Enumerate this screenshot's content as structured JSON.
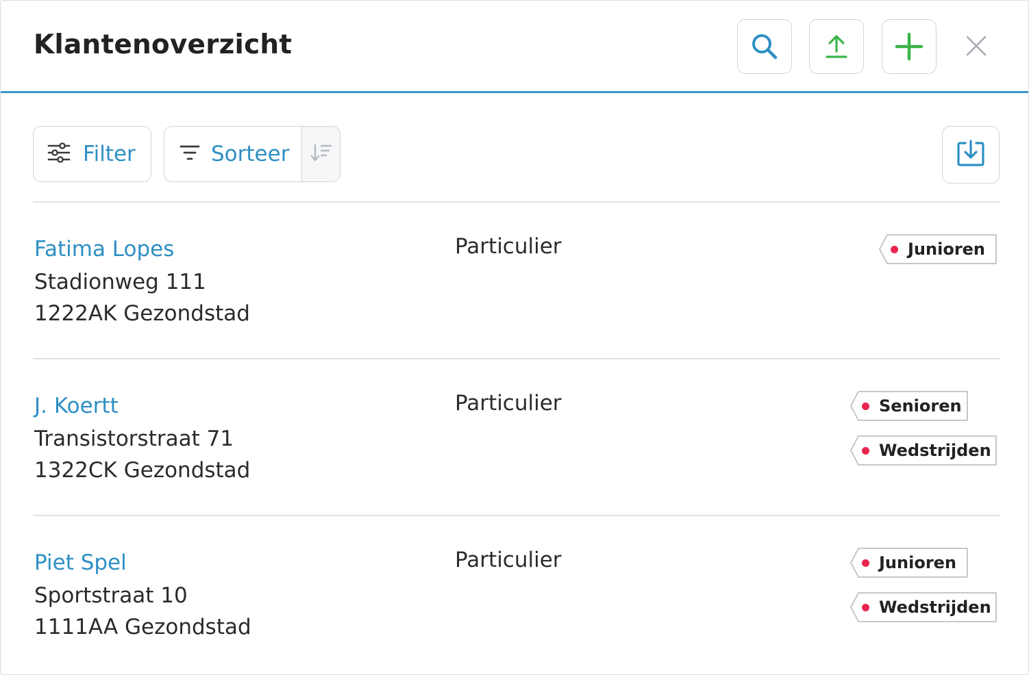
{
  "header": {
    "title": "Klantenoverzicht",
    "actions": [
      {
        "name": "search",
        "icon": "search-icon",
        "color": "#2e8fc4"
      },
      {
        "name": "upload",
        "icon": "upload-icon",
        "color": "#3cb44a"
      },
      {
        "name": "add",
        "icon": "plus-icon",
        "color": "#3cb44a"
      }
    ],
    "close_icon": "close-icon",
    "accent_color": "#3d96c7"
  },
  "toolbar": {
    "filter_label": "Filter",
    "filter_icon": "sliders-icon",
    "sort_label": "Sorteer",
    "sort_icon": "sort-lines-icon",
    "sort_direction_icon": "sort-descending-icon",
    "download_icon": "download-icon"
  },
  "customers": [
    {
      "name": "Fatima Lopes",
      "street": "Stadionweg 111",
      "city": "1222AK Gezondstad",
      "type": "Particulier",
      "tags": [
        "Junioren"
      ]
    },
    {
      "name": "J. Koertt",
      "street": "Transistorstraat 71",
      "city": "1322CK Gezondstad",
      "type": "Particulier",
      "tags": [
        "Senioren",
        "Wedstrijden"
      ]
    },
    {
      "name": "Piet Spel",
      "street": "Sportstraat 10",
      "city": "1111AA Gezondstad",
      "type": "Particulier",
      "tags": [
        "Junioren",
        "Wedstrijden"
      ]
    }
  ],
  "colors": {
    "link": "#2e8fc4",
    "tag_dot": "#e8244f",
    "success": "#3cb44a"
  }
}
